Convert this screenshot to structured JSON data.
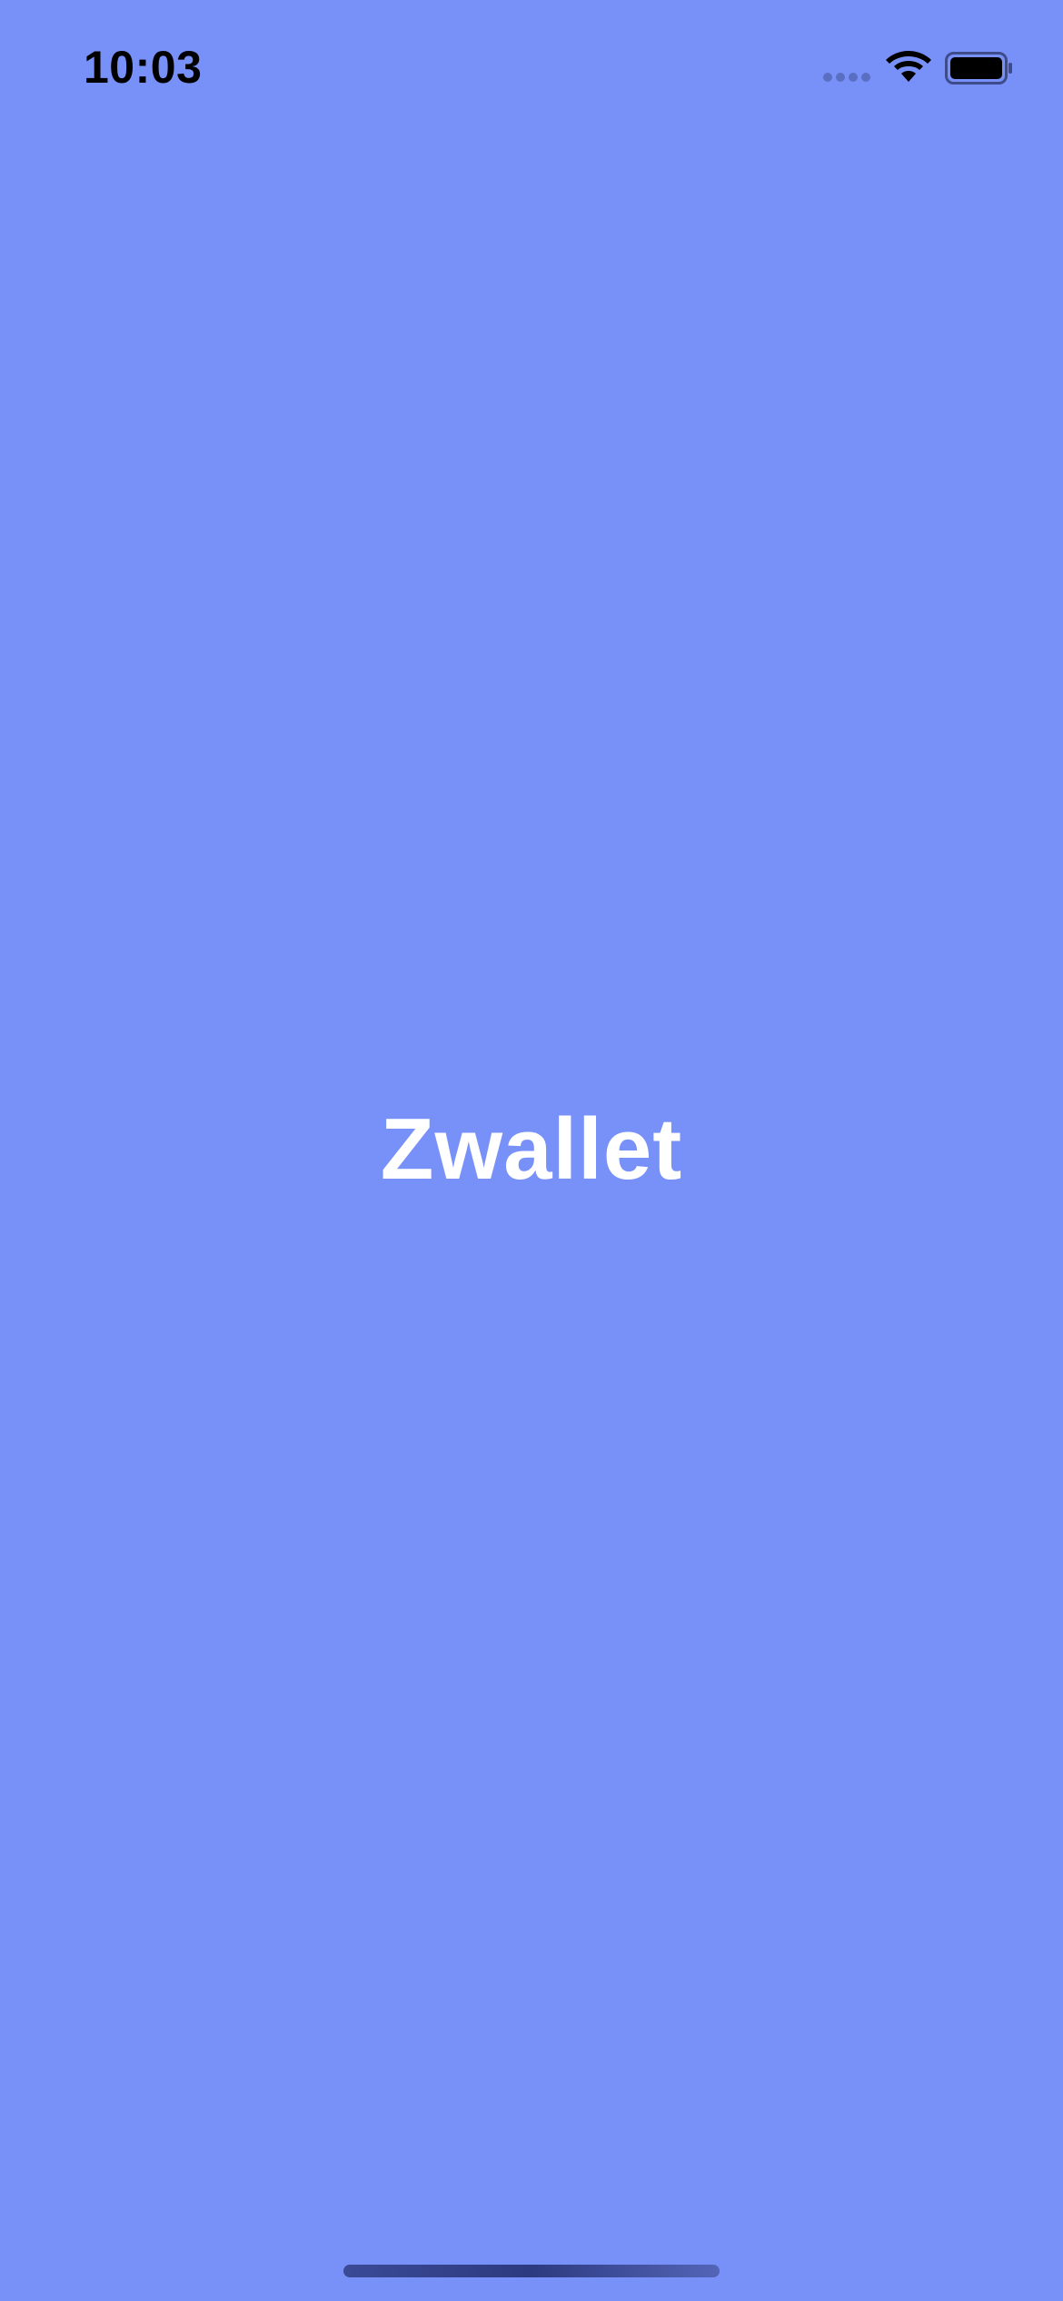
{
  "status_bar": {
    "time": "10:03",
    "icons": [
      "cellular-signal-icon",
      "wifi-icon",
      "battery-icon"
    ]
  },
  "splash": {
    "title": "Zwallet"
  },
  "colors": {
    "background": "#7891F8",
    "title": "#FFFFFF",
    "status_text": "#000000"
  }
}
